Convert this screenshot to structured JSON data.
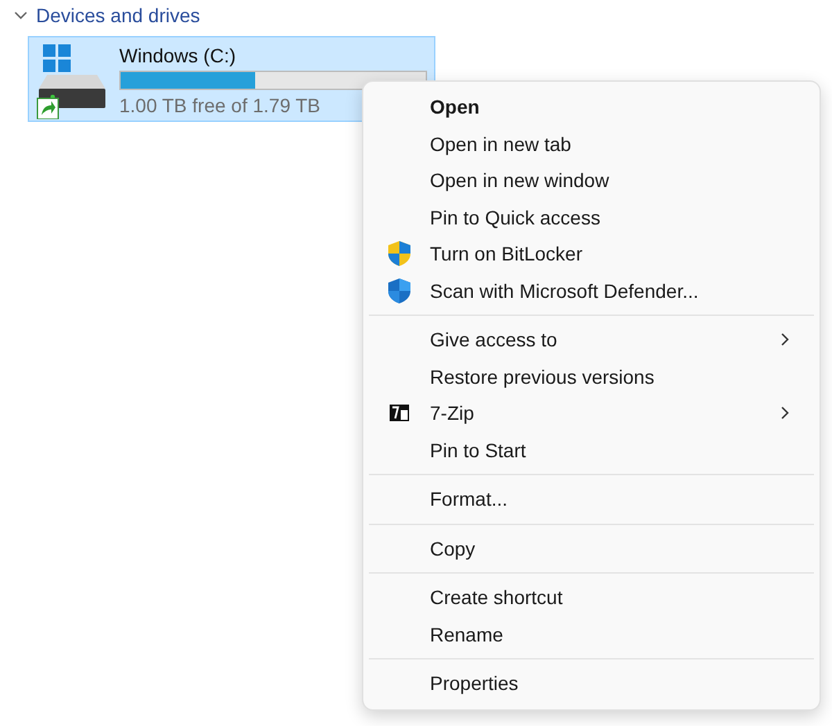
{
  "section": {
    "title": "Devices and drives",
    "expanded": true
  },
  "drive": {
    "name": "Windows (C:)",
    "level": 0.44,
    "space": "1.00 TB free of 1.79 TB",
    "selected": true
  },
  "menu": {
    "groups": [
      {
        "items": [
          {
            "label": "Open",
            "bold": true,
            "kind": "plain",
            "submenu": false
          },
          {
            "label": "Open in new tab",
            "bold": false,
            "kind": "plain",
            "submenu": false
          },
          {
            "label": "Open in new window",
            "bold": false,
            "kind": "plain",
            "submenu": false
          },
          {
            "label": "Pin to Quick access",
            "bold": false,
            "kind": "plain",
            "submenu": false
          },
          {
            "label": "Turn on BitLocker",
            "bold": false,
            "kind": "shield",
            "submenu": false
          },
          {
            "label": "Scan with Microsoft Defender...",
            "bold": false,
            "kind": "scan",
            "submenu": false
          }
        ]
      },
      {
        "items": [
          {
            "label": "Give access to",
            "bold": false,
            "kind": "plain",
            "submenu": true
          },
          {
            "label": "Restore previous versions",
            "bold": false,
            "kind": "plain",
            "submenu": false
          },
          {
            "label": "7-Zip",
            "bold": false,
            "kind": "archive",
            "submenu": true
          },
          {
            "label": "Pin to Start",
            "bold": false,
            "kind": "plain",
            "submenu": false
          }
        ]
      },
      {
        "items": [
          {
            "label": "Format...",
            "bold": false,
            "kind": "plain",
            "submenu": false
          }
        ]
      },
      {
        "items": [
          {
            "label": "Copy",
            "bold": false,
            "kind": "plain",
            "submenu": false
          }
        ]
      },
      {
        "items": [
          {
            "label": "Create shortcut",
            "bold": false,
            "kind": "plain",
            "submenu": false
          },
          {
            "label": "Rename",
            "bold": false,
            "kind": "plain",
            "submenu": false
          }
        ]
      },
      {
        "items": [
          {
            "label": "Properties",
            "bold": false,
            "kind": "plain",
            "submenu": false
          }
        ]
      }
    ]
  }
}
